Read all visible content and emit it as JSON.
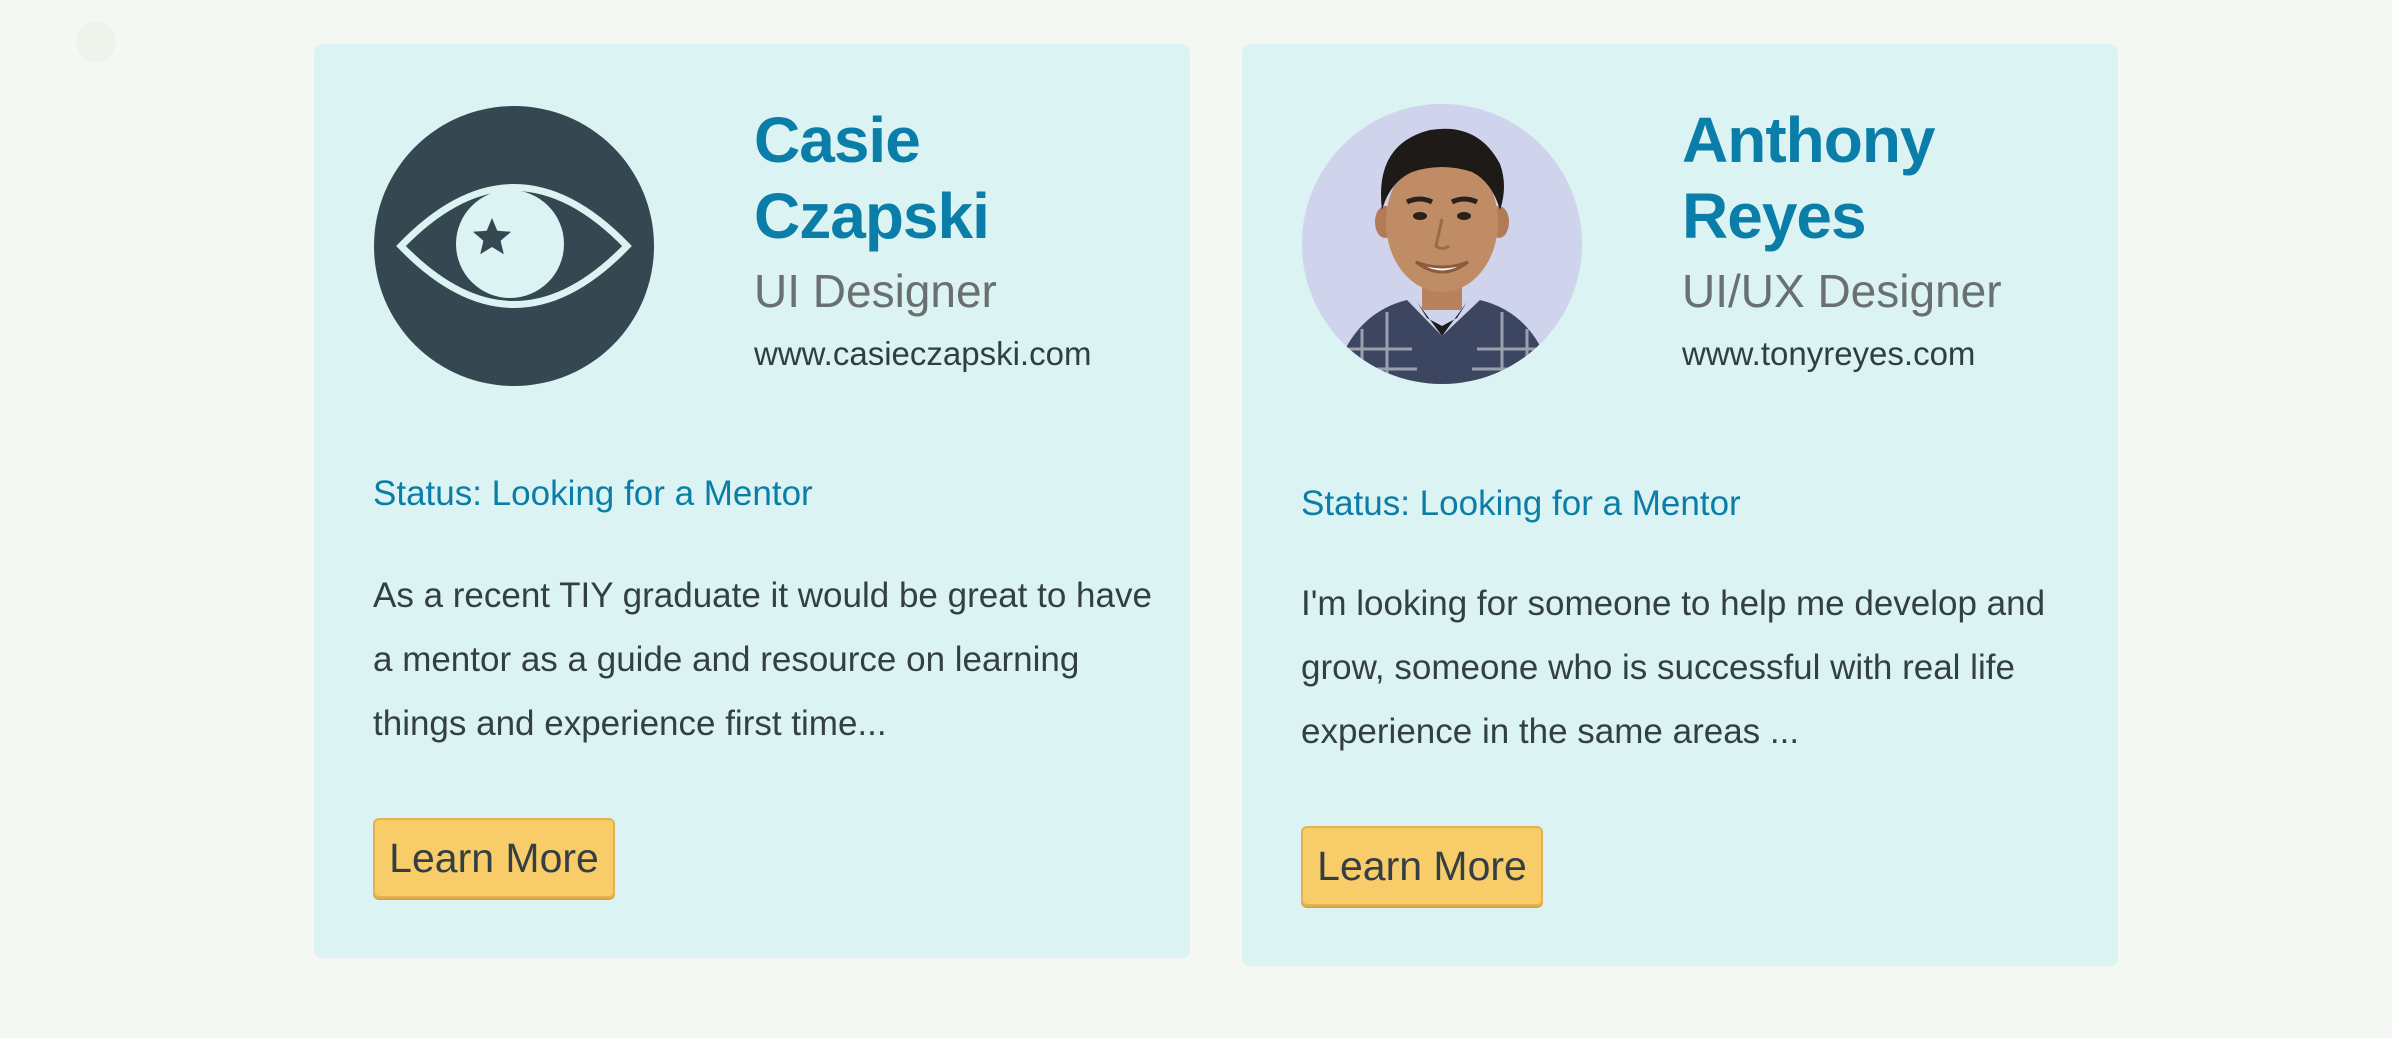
{
  "colors": {
    "page_background": "#f4f8f2",
    "card_background": "#dcf3f3",
    "accent": "#0a7ea8",
    "button": "#f8cc68",
    "text": "#333f45"
  },
  "cards": [
    {
      "name": "Casie Czapski",
      "role": "UI Designer",
      "website": "www.casieczapski.com",
      "avatar_icon": "eye-with-star-icon",
      "status": "Status: Looking for a Mentor",
      "bio": "As a recent TIY graduate it would be great to have a mentor as a guide and resource on learning things and experience first time...",
      "button_label": "Learn More"
    },
    {
      "name": "Anthony Reyes",
      "role": "UI/UX Designer",
      "website": "www.tonyreyes.com",
      "avatar_icon": "profile-photo",
      "status": "Status: Looking for a Mentor",
      "bio": "I'm looking for someone to help me develop and grow, someone who is successful with real life experience in the same areas ...",
      "button_label": "Learn More"
    }
  ]
}
